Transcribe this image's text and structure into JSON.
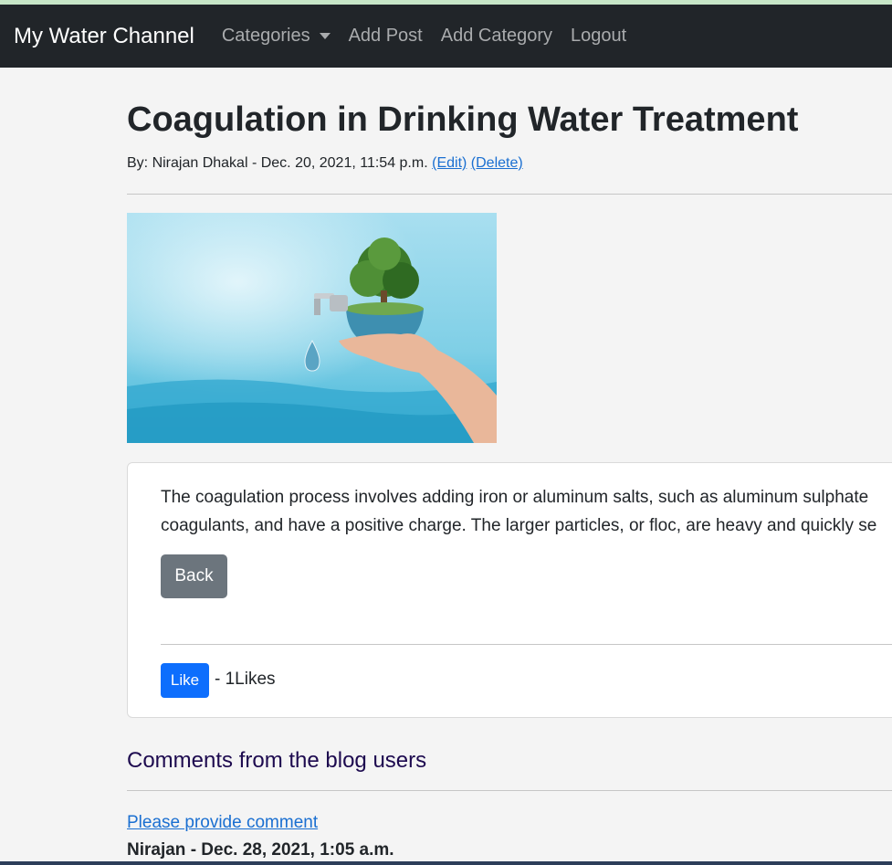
{
  "navbar": {
    "brand": "My Water Channel",
    "links": [
      "Categories",
      "Add Post",
      "Add Category",
      "Logout"
    ]
  },
  "post": {
    "title": "Coagulation in Drinking Water Treatment",
    "meta": "By: Nirajan Dhakal - Dec. 20, 2021, 11:54 p.m.",
    "edit_label": "(Edit)",
    "delete_label": "(Delete)",
    "body_line1": "The coagulation process involves adding iron or aluminum salts, such as aluminum sulphate",
    "body_line2": "coagulants, and have a positive charge. The larger particles, or floc, are heavy and quickly se",
    "back_label": "Back",
    "like_label": "Like",
    "likes_text": "- 1Likes"
  },
  "comments": {
    "heading": "Comments from the blog users",
    "provide_link": "Please provide comment",
    "first_author": "Nirajan - Dec. 28, 2021, 1:05 a.m."
  },
  "colors": {
    "navbar_bg": "#212529",
    "link": "#1a6fd1",
    "like_button": "#0d6efd",
    "back_button": "#6c757d"
  }
}
